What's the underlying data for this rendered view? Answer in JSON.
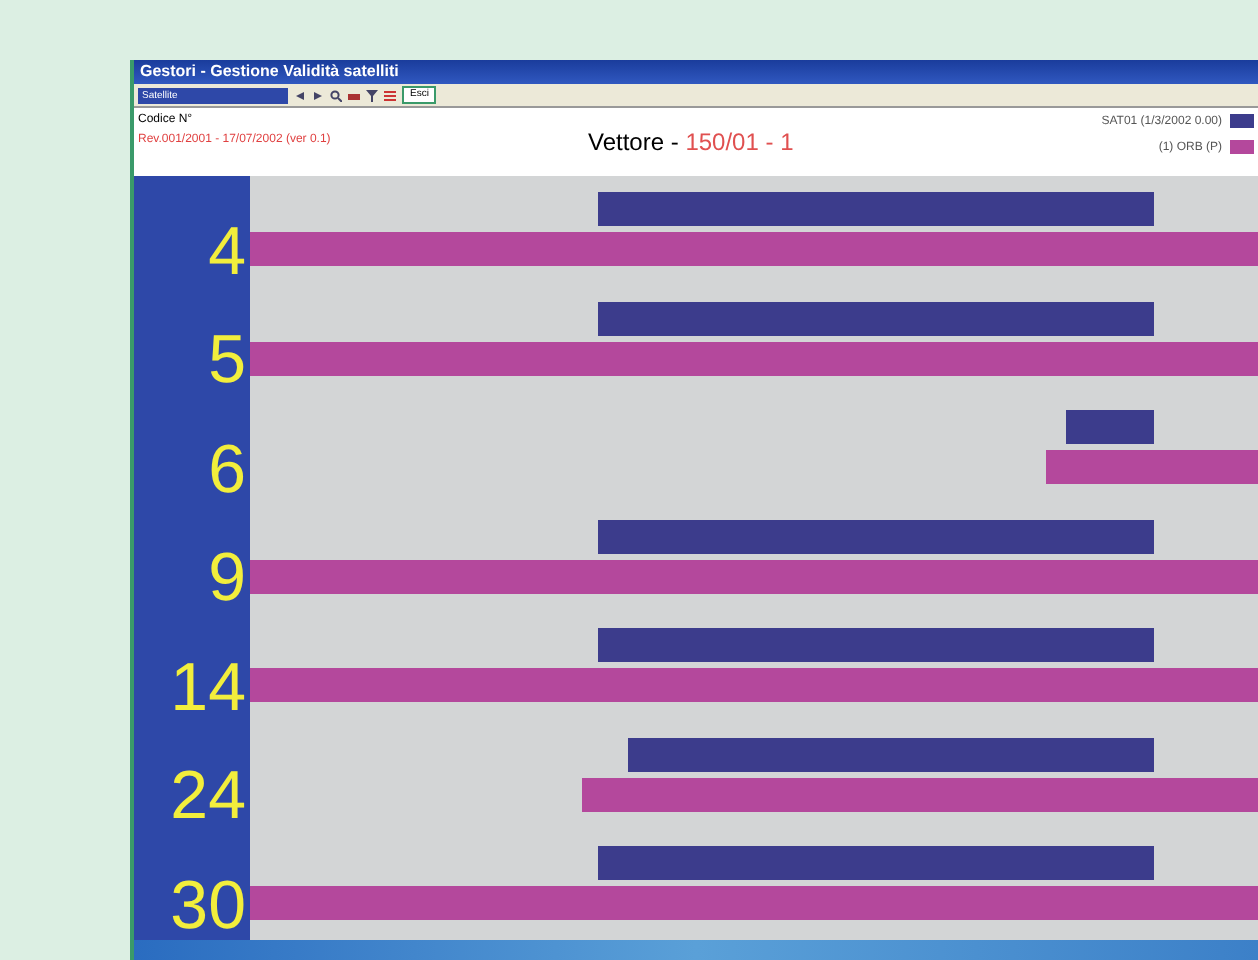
{
  "window": {
    "title": "Gestori - Gestione Validità satelliti"
  },
  "toolbar": {
    "dropdown": "Satellite",
    "button": "Esci"
  },
  "header": {
    "code_label": "Codice N°",
    "revision": "Rev.001/2001 - 17/07/2002 (ver 0.1)",
    "vettore_label": "Vettore -",
    "vettore_value": "150/01 - 1"
  },
  "legend": [
    {
      "label": "SAT01 (1/3/2002 0.00)",
      "color": "#3c3c8c"
    },
    {
      "label": "(1) ORB (P)",
      "color": "#b4489c"
    }
  ],
  "rows": [
    {
      "label": "4"
    },
    {
      "label": "5"
    },
    {
      "label": "6"
    },
    {
      "label": "9"
    },
    {
      "label": "14"
    },
    {
      "label": "24"
    },
    {
      "label": "30"
    }
  ]
}
